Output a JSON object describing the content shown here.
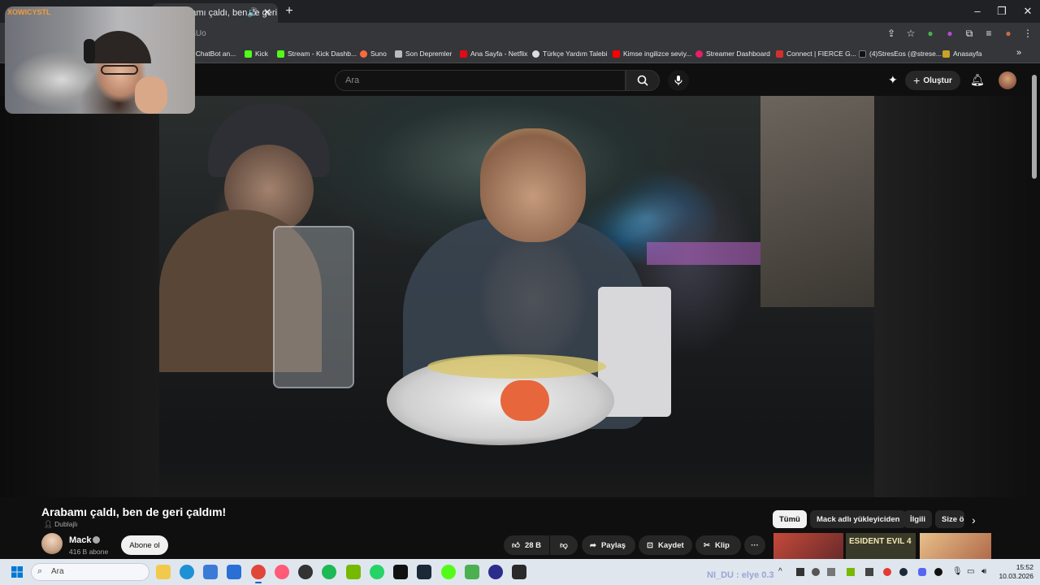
{
  "browser": {
    "active_tab_title": "Arabamı çaldı, ben de geri çaldım!",
    "url_visible": "raUo",
    "bookmarks": [
      {
        "label": "t ChatBot an...",
        "color": "#4a6"
      },
      {
        "label": "Kick",
        "color": "#53fc18"
      },
      {
        "label": "Stream - Kick Dashb...",
        "color": "#53fc18"
      },
      {
        "label": "Suno",
        "color": "#ff6a3d"
      },
      {
        "label": "Son Depremler",
        "color": "#bbbbbb"
      },
      {
        "label": "Ana Sayfa - Netflix",
        "color": "#e50914"
      },
      {
        "label": "Türkçe Yardım Talebi",
        "color": "#dddddd"
      },
      {
        "label": "Kimse ingilizce seviy...",
        "color": "#ff0000"
      },
      {
        "label": "Streamer Dashboard",
        "color": "#e91e63"
      },
      {
        "label": "Connect | FIERCE G...",
        "color": "#d32f2f"
      },
      {
        "label": "(4)StresEos (@strese...",
        "color": "#111111"
      },
      {
        "label": "Anasayfa",
        "color": "#c9a227"
      }
    ]
  },
  "youtube": {
    "search_placeholder": "Ara",
    "create_label": "Oluştur",
    "video": {
      "title": "Arabamı çaldı, ben de geri çaldım!",
      "dubbed_label": "Dublajlı",
      "channel_name": "Mack",
      "subscribers": "416 B abone",
      "subscribe_label": "Abone ol",
      "like_count": "28 B",
      "share_label": "Paylaş",
      "save_label": "Kaydet",
      "clip_label": "Klip",
      "more_label": "···"
    },
    "chips": [
      "Tümü",
      "Mack adlı yükleyiciden",
      "İlgili",
      "Size ö"
    ],
    "thumb_text": "ESIDENT EVIL 4"
  },
  "webcam": {
    "label": "XOWICYSTL"
  },
  "taskbar": {
    "search_placeholder": "Ara",
    "overlay_text": "NI_DU : elye 0.3",
    "time": "15:52",
    "date": "10.03.2026"
  },
  "colors": {
    "yt_bg": "#0f0f0f",
    "pill_bg": "#272727",
    "accent_blue": "#0067c0"
  }
}
